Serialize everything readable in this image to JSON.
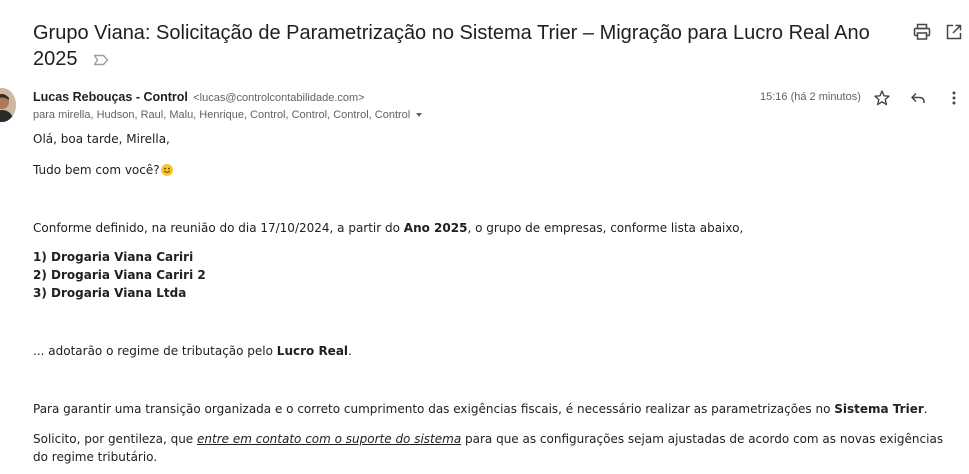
{
  "email": {
    "subject": "Grupo Viana: Solicitação de Parametrização no Sistema Trier – Migração para Lucro Real Ano 2025",
    "sender_name": "Lucas Rebouças - Control",
    "sender_email": "<lucas@controlcontabilidade.com>",
    "recipients": "para mirella, Hudson, Raul, Malu, Henrique, Control, Control, Control, Control",
    "time": "15:16 (há 2 minutos)"
  },
  "body": {
    "greeting": "Olá, boa tarde, Mirella,",
    "how_are_you": "Tudo bem com você?",
    "p1_a": "Conforme definido, na reunião do dia 17/10/2024, a partir do ",
    "p1_b": "Ano 2025",
    "p1_c": ", o grupo de empresas, conforme lista abaixo,",
    "companies": [
      "1) Drogaria Viana Cariri",
      "2) Drogaria Viana Cariri 2",
      "3) Drogaria Viana Ltda"
    ],
    "p2_a": "... adotarão o regime de tributação pelo ",
    "p2_b": "Lucro Real",
    "p2_c": ".",
    "p3_a": "Para garantir uma transição organizada e o correto cumprimento das exigências fiscais, é necessário realizar as parametrizações no ",
    "p3_b": "Sistema Trier",
    "p3_c": ".",
    "p4_a": "Solicito, por gentileza, que ",
    "p4_link": "entre em contato com o suporte do sistema",
    "p4_b": " para que as configurações sejam ajustadas de acordo com as novas exigências do regime tributário."
  },
  "icons": {
    "label": "label-outline-icon",
    "print": "print-icon",
    "open_new_window": "open-in-new-window-icon",
    "star": "star-icon",
    "reply": "reply-icon",
    "more": "more-vertical-icon",
    "avatar": "sender-avatar",
    "emoji": "smiling-face-emoji"
  },
  "colors": {
    "text": "#202124",
    "secondary_text": "#5f6368",
    "icon": "#444746",
    "emoji": "#f7c531"
  }
}
